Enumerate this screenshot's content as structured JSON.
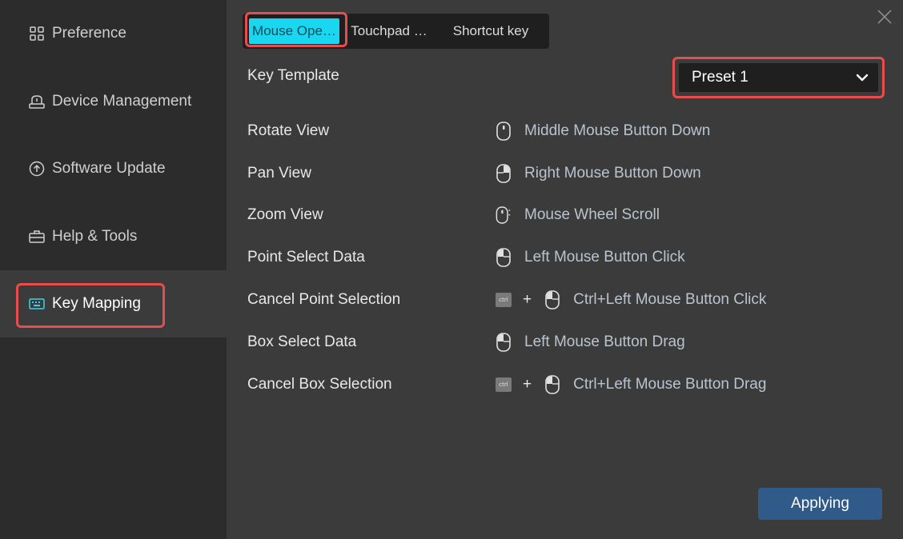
{
  "sidebar": {
    "items": [
      {
        "label": "Preference",
        "icon": "grid-icon"
      },
      {
        "label": "Device Management",
        "icon": "device-icon"
      },
      {
        "label": "Software Update",
        "icon": "update-icon"
      },
      {
        "label": "Help & Tools",
        "icon": "toolbox-icon"
      },
      {
        "label": "Key Mapping",
        "icon": "keyboard-icon",
        "active": true
      }
    ]
  },
  "tabs": [
    {
      "label": "Mouse Ope…",
      "active": true
    },
    {
      "label": "Touchpad …"
    },
    {
      "label": "Shortcut key"
    }
  ],
  "template": {
    "label": "Key Template",
    "selected": "Preset 1"
  },
  "mappings": [
    {
      "action": "Rotate View",
      "binding": "Middle Mouse Button Down",
      "mouse": "middle"
    },
    {
      "action": "Pan View",
      "binding": "Right Mouse Button Down",
      "mouse": "right"
    },
    {
      "action": "Zoom View",
      "binding": "Mouse Wheel Scroll",
      "mouse": "wheel"
    },
    {
      "action": "Point Select Data",
      "binding": "Left Mouse Button Click",
      "mouse": "left"
    },
    {
      "action": "Cancel Point Selection",
      "binding": "Ctrl+Left Mouse Button Click",
      "mouse": "left",
      "ctrl": "ctrl",
      "plus": "+"
    },
    {
      "action": "Box Select Data",
      "binding": "Left Mouse Button Drag",
      "mouse": "left"
    },
    {
      "action": "Cancel Box Selection",
      "binding": "Ctrl+Left Mouse Button Drag",
      "mouse": "left",
      "ctrl": "ctrl",
      "plus": "+"
    }
  ],
  "apply_label": "Applying",
  "colors": {
    "accent_tab": "#19d7f0",
    "highlight": "#e84d4d",
    "button": "#2f5a8a"
  }
}
